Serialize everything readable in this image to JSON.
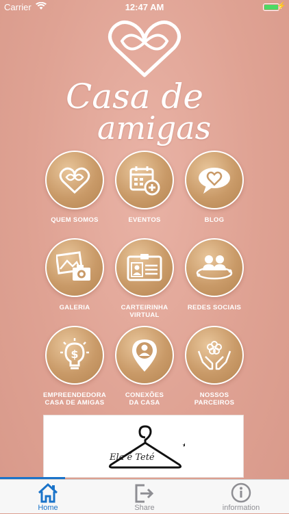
{
  "status_bar": {
    "carrier": "Carrier",
    "time": "12:47 AM"
  },
  "logo": {
    "line1": "Casa de",
    "line2": "amigas"
  },
  "tiles": [
    {
      "label": "QUEM SOMOS",
      "icon": "heart-infinity-icon"
    },
    {
      "label": "EVENTOS",
      "icon": "calendar-add-icon"
    },
    {
      "label": "BLOG",
      "icon": "speech-bubble-heart-icon"
    },
    {
      "label": "GALERIA",
      "icon": "photos-camera-icon"
    },
    {
      "label": "CARTEIRINHA\nVIRTUAL",
      "icon": "id-card-icon"
    },
    {
      "label": "REDES SOCIAIS",
      "icon": "people-network-icon"
    },
    {
      "label": "EMPREENDEDORA\nCASA DE AMIGAS",
      "icon": "lightbulb-dollar-icon"
    },
    {
      "label": "CONEXÕES\nDA CASA",
      "icon": "location-person-icon"
    },
    {
      "label": "NOSSOS\nPARCEIROS",
      "icon": "hands-flower-icon"
    }
  ],
  "banner": {
    "text": "Ela é Teté",
    "icon": "hanger-icon"
  },
  "tabbar": {
    "tabs": [
      {
        "label": "Home",
        "icon": "home-icon",
        "active": true
      },
      {
        "label": "Share",
        "icon": "share-exit-icon",
        "active": false
      },
      {
        "label": "information",
        "icon": "info-icon",
        "active": false
      }
    ]
  },
  "colors": {
    "background": "#dfa293",
    "tile": "#c99a68",
    "active_tab": "#1a73c9"
  }
}
